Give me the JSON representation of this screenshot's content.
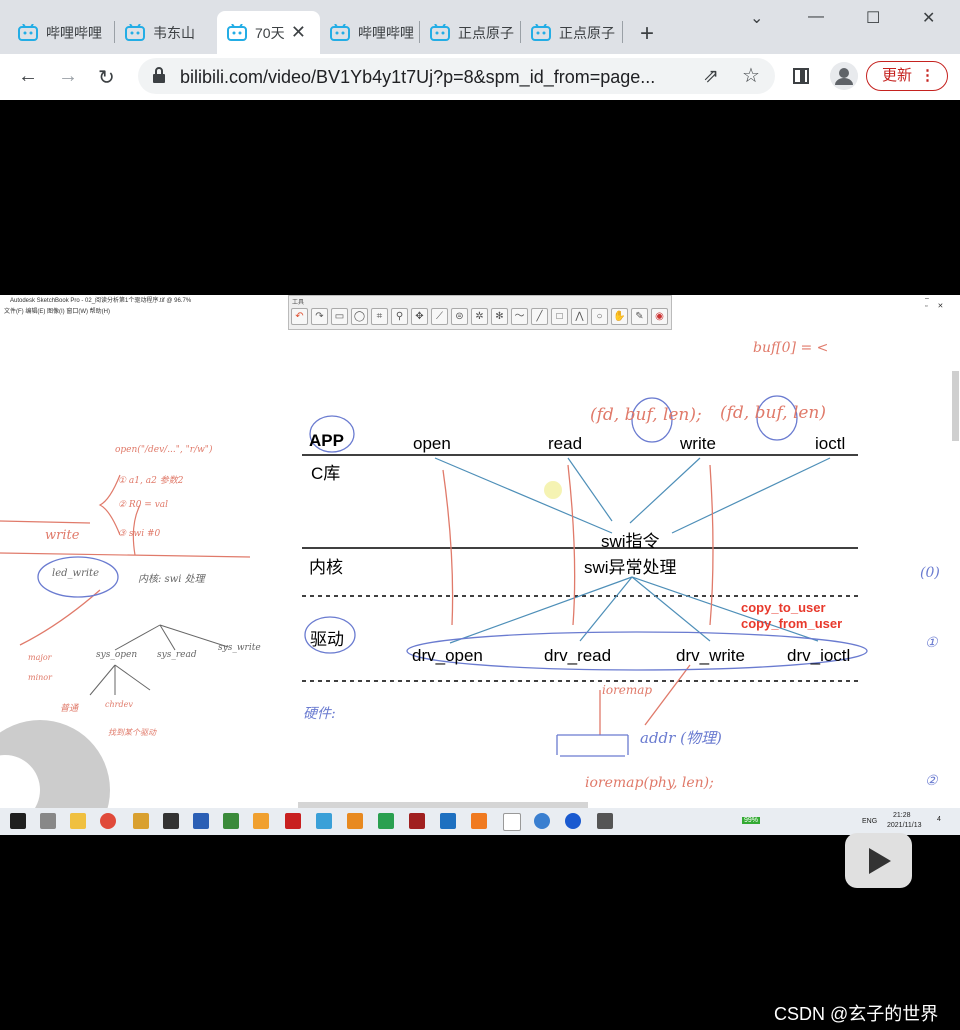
{
  "browser": {
    "tabs": [
      {
        "label": "哔哩哔哩"
      },
      {
        "label": "韦东山"
      },
      {
        "label": "70天"
      },
      {
        "label": "哔哩哔哩"
      },
      {
        "label": "正点原子"
      },
      {
        "label": "正点原子"
      }
    ],
    "url": "bilibili.com/video/BV1Yb4y1t7Uj?p=8&spm_id_from=page...",
    "update_label": "更新",
    "new_tab_symbol": "+",
    "menu_symbol": "⋮",
    "tab_close_symbol": "✕"
  },
  "sketchbook": {
    "title": "Autodesk SketchBook Pro - 02_阅读分析第1个驱动程序.tif @ 96.7%",
    "menu": "文件(F)   编辑(E)   图像(I)   窗口(W)   帮助(H)",
    "tools_title": "工具"
  },
  "diagram": {
    "rows": {
      "app": "APP",
      "clib": "C库",
      "kernel": "内核",
      "driver": "驱动"
    },
    "app_calls": [
      "open",
      "read",
      "write",
      "ioctl"
    ],
    "swi": "swi指令",
    "swi_handler": "swi异常处理",
    "drivers": [
      "drv_open",
      "drv_read",
      "drv_write",
      "drv_ioctl"
    ],
    "copy_to_user": "copy_to_user",
    "copy_from_user": "copy_from_user"
  },
  "handwriting": {
    "read_args": "(fd, buf, len);",
    "write_args": "(fd, buf, len)",
    "buf_note": "buf[0] = <",
    "hardware": "硬件:",
    "ioremap": "ioremap",
    "addr": "addr (物理)",
    "remap_call": "ioremap(phy, len);",
    "left_notes": [
      "open(\"/dev/...\", \"r/w\")",
      "① a1, a2  参数2",
      "② R0 = val",
      "③ swi #0",
      "write",
      "led_write",
      "内核: swi 处理",
      "sys_open",
      "sys_read",
      "sys_write",
      "普通",
      "chrdev",
      "找到某个驱动",
      "major",
      "minor"
    ],
    "right_marks": [
      "(0)",
      "①",
      "②"
    ]
  },
  "taskbar": {
    "time": "21:28",
    "date": "2021/11/13",
    "battery": "99%",
    "lang": "ENG",
    "notif_count": "4"
  },
  "watermark": "CSDN @玄子的世界",
  "colors": {
    "bilibili_blue": "#23ade5",
    "update_red": "#c5221f",
    "arrow_blue": "#4e8fb8",
    "hand_red": "#e07a6a",
    "label_red": "#e8392c"
  }
}
